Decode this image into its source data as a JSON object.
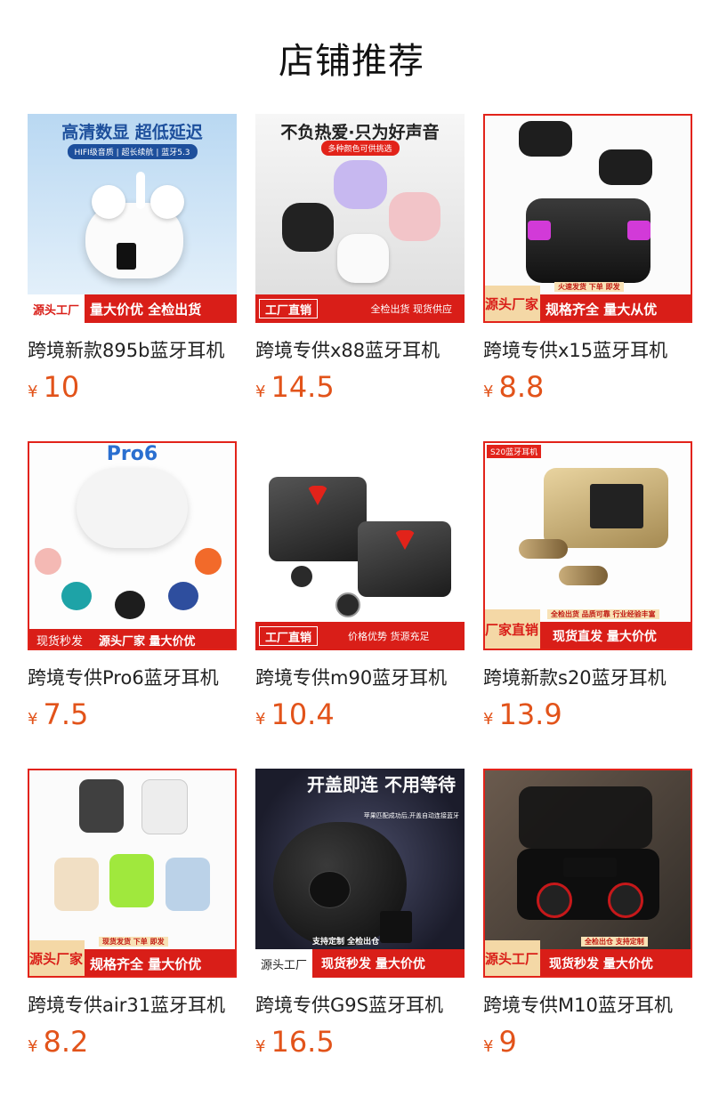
{
  "section_title": "店铺推荐",
  "currency": "¥",
  "products": [
    {
      "title": "跨境新款895b蓝牙耳机",
      "price": "10",
      "image": {
        "headline": "高清数显 超低延迟",
        "subline": "HIFI级音质 | 超长续航 | 蓝牙5.3",
        "banner_tag": "源头工厂",
        "banner_text": "量大价优 全检出货"
      }
    },
    {
      "title": "跨境专供x88蓝牙耳机",
      "price": "14.5",
      "image": {
        "headline": "不负热爱·只为好声音",
        "subline": "多种颜色可供挑选",
        "banner_tag": "工厂直销",
        "banner_text": "全检出货 现货供应"
      }
    },
    {
      "title": "跨境专供x15蓝牙耳机",
      "price": "8.8",
      "image": {
        "banner_tag": "源头厂家",
        "banner_minor": "火速发货 下单 即发",
        "banner_text": "规格齐全 量大从优"
      }
    },
    {
      "title": "跨境专供Pro6蓝牙耳机",
      "price": "7.5",
      "image": {
        "model": "Pro6",
        "banner_tag": "现货秒发",
        "banner_text": "源头厂家 量大价优"
      }
    },
    {
      "title": "跨境专供m90蓝牙耳机",
      "price": "10.4",
      "image": {
        "banner_tag": "工厂直销",
        "banner_text": "价格优势 货源充足"
      }
    },
    {
      "title": "跨境新款s20蓝牙耳机",
      "price": "13.9",
      "image": {
        "topline": "S20蓝牙耳机",
        "banner_tag": "厂家直销",
        "banner_minor": "全检出货 品质可靠 行业经验丰富",
        "banner_text": "现货直发 量大价优"
      }
    },
    {
      "title": "跨境专供air31蓝牙耳机",
      "price": "8.2",
      "image": {
        "banner_tag": "源头厂家",
        "banner_minor": "现货发货 下单 即发",
        "banner_text": "规格齐全 量大价优"
      }
    },
    {
      "title": "跨境专供G9S蓝牙耳机",
      "price": "16.5",
      "image": {
        "headline": "开盖即连 不用等待",
        "subline": "苹果匹配成功后,开盖自动连接蓝牙",
        "minor": "支持定制 全检出仓",
        "banner_tag": "源头工厂",
        "banner_text": "现货秒发 量大价优"
      }
    },
    {
      "title": "跨境专供M10蓝牙耳机",
      "price": "9",
      "image": {
        "banner_tag": "源头工厂",
        "banner_minor": "全检出仓 支持定制",
        "banner_text": "现货秒发 量大价优"
      }
    }
  ]
}
